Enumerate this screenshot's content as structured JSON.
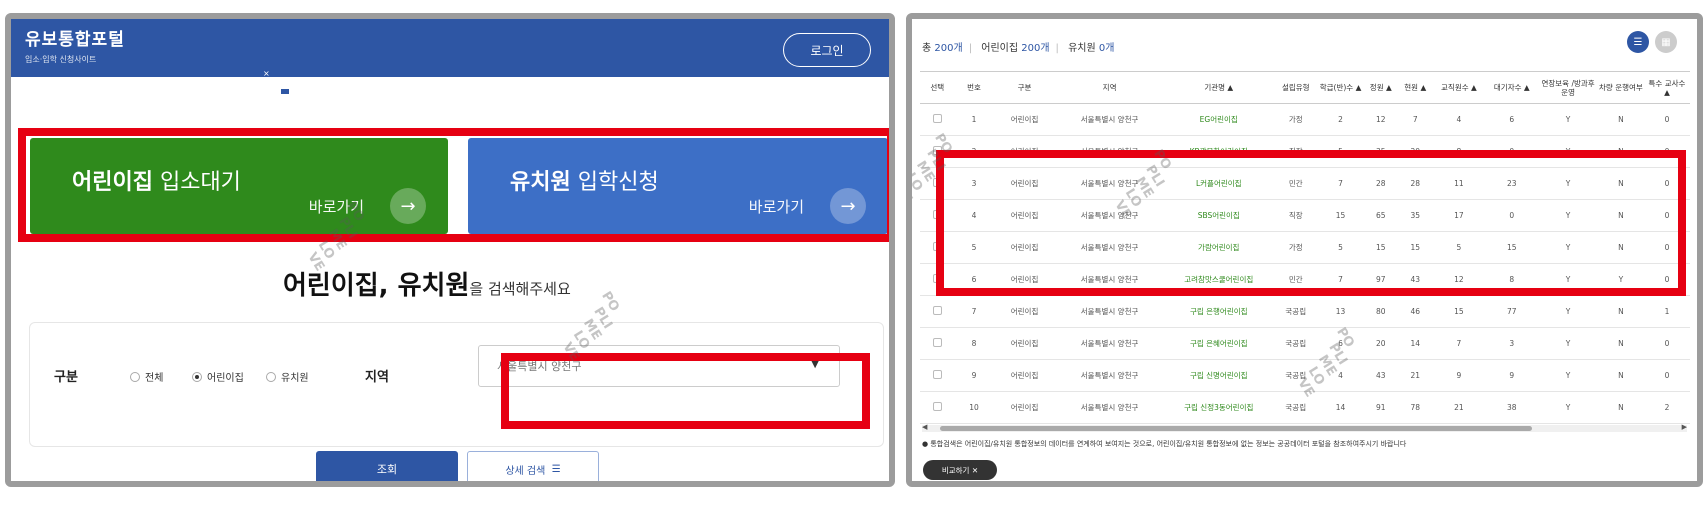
{
  "left": {
    "header": {
      "title": "유보통합포털",
      "subtitle": "입소·입학 신청사이트",
      "login_label": "로그인",
      "close": "×"
    },
    "cards": [
      {
        "bold": "어린이집",
        "light": " 입소대기",
        "go_label": "바로가기",
        "arrow": "→",
        "color": "#2f8a1c"
      },
      {
        "bold": "유치원",
        "light": " 입학신청",
        "go_label": "바로가기",
        "arrow": "→",
        "color": "#3d6fc6"
      }
    ],
    "search_heading": {
      "part1": "어린이집, 유치원",
      "part2": "을 검색해주세요"
    },
    "filter": {
      "category_label": "구분",
      "options": [
        "전체",
        "어린이집",
        "유치원"
      ],
      "selected": "어린이집",
      "region_label": "지역",
      "region_value": "서울특별시 양천구"
    },
    "buttons": {
      "search": "조회",
      "detail": "상세 검색",
      "detail_icon": "☰"
    }
  },
  "right": {
    "totals": {
      "total_prefix": "총",
      "total_count": "200개",
      "daycare_label": "어린이집",
      "daycare_count": "200개",
      "kinder_label": "유치원",
      "kinder_count": "0개"
    },
    "columns": [
      "선택",
      "번호",
      "구분",
      "지역",
      "기관명 ▲",
      "설립유형",
      "학급(반)수 ▲",
      "정원 ▲",
      "현원 ▲",
      "교직원수 ▲",
      "대기자수 ▲",
      "연장보육 /방과후운영",
      "차량 운행여부",
      "특수 교사수 ▲"
    ],
    "rows": [
      [
        "",
        "1",
        "어린이집",
        "서울특별시 양천구",
        "EG어린이집",
        "가정",
        "2",
        "12",
        "7",
        "4",
        "6",
        "Y",
        "N",
        "0"
      ],
      [
        "",
        "2",
        "어린이집",
        "서울특별시 양천구",
        "KB광목한어린이집",
        "직장",
        "5",
        "35",
        "20",
        "8",
        "0",
        "Y",
        "N",
        "0"
      ],
      [
        "",
        "3",
        "어린이집",
        "서울특별시 양천구",
        "L커플어린이집",
        "민간",
        "7",
        "28",
        "28",
        "11",
        "23",
        "Y",
        "N",
        "0"
      ],
      [
        "",
        "4",
        "어린이집",
        "서울특별시 양천구",
        "SBS어린이집",
        "직장",
        "15",
        "65",
        "35",
        "17",
        "0",
        "Y",
        "N",
        "0"
      ],
      [
        "",
        "5",
        "어린이집",
        "서울특별시 양천구",
        "가람어린이집",
        "가정",
        "5",
        "15",
        "15",
        "5",
        "15",
        "Y",
        "N",
        "0"
      ],
      [
        "",
        "6",
        "어린이집",
        "서울특별시 양천구",
        "고려참맛스쿨어린이집",
        "민간",
        "7",
        "97",
        "43",
        "12",
        "8",
        "Y",
        "Y",
        "0"
      ],
      [
        "",
        "7",
        "어린이집",
        "서울특별시 양천구",
        "구립 은행어린이집",
        "국공립",
        "13",
        "80",
        "46",
        "15",
        "77",
        "Y",
        "N",
        "1"
      ],
      [
        "",
        "8",
        "어린이집",
        "서울특별시 양천구",
        "구립 은혜어린이집",
        "국공립",
        "6",
        "20",
        "14",
        "7",
        "3",
        "Y",
        "N",
        "0"
      ],
      [
        "",
        "9",
        "어린이집",
        "서울특별시 양천구",
        "구립 신명어린이집",
        "국공립",
        "4",
        "43",
        "21",
        "9",
        "9",
        "Y",
        "N",
        "0"
      ],
      [
        "",
        "10",
        "어린이집",
        "서울특별시 양천구",
        "구립 신정3동어린이집",
        "국공립",
        "14",
        "91",
        "78",
        "21",
        "38",
        "Y",
        "N",
        "2"
      ]
    ],
    "notice": "● 통합검색은 어린이집/유치원 통합정보의 데이터를 연계하여 보여지는 것으로, 어린이집/유치원 통합정보에 없는 정보는 공공데이터 포털을 참조하여주시기 바랍니다",
    "compare_label": "비교하기 ✕",
    "scroll_left": "◀",
    "scroll_right": "▶"
  },
  "colors": {
    "primary_blue": "#2e56a4",
    "green": "#2f8a1c",
    "highlight_red": "#e60012"
  }
}
